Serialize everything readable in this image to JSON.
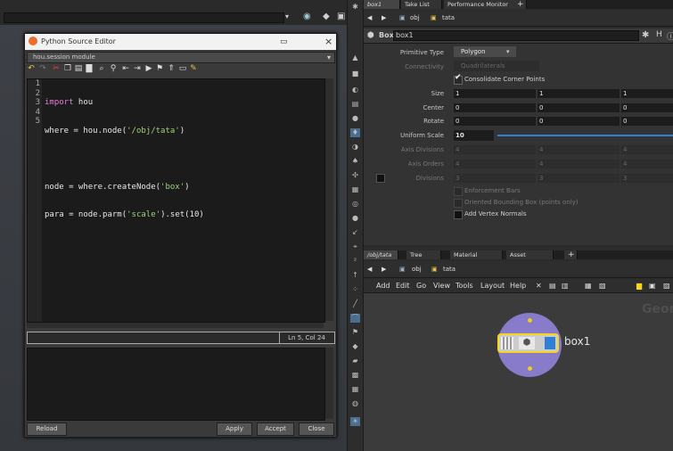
{
  "top_strip": {},
  "editor": {
    "title": "Python Source Editor",
    "module": "hou.session module",
    "line_numbers": [
      "1",
      "2",
      "3",
      "4",
      "5"
    ],
    "code_lines": [
      {
        "kw": "import",
        "rest": " hou",
        "str": "",
        "tail": ""
      },
      {
        "kw": "",
        "rest": "where = hou.node(",
        "str": "'/obj/tata'",
        "tail": ")"
      },
      {
        "kw": "",
        "rest": "",
        "str": "",
        "tail": ""
      },
      {
        "kw": "",
        "rest": "node = where.createNode(",
        "str": "'box'",
        "tail": ")"
      },
      {
        "kw": "",
        "rest": "para = node.parm(",
        "str": "'scale'",
        "tail": ").set(10)"
      }
    ],
    "status": "Ln 5, Col 24",
    "buttons": {
      "reload": "Reload",
      "apply": "Apply",
      "accept": "Accept",
      "close": "Close"
    }
  },
  "param_pane": {
    "tabs": [
      "box1",
      "Take List",
      "Performance Monitor",
      "+"
    ],
    "path": {
      "obj": "obj",
      "node": "tata"
    },
    "node_type": "Box",
    "node_name": "box1",
    "primitive_type_label": "Primitive Type",
    "primitive_type_value": "Polygon",
    "connectivity_label": "Connectivity",
    "connectivity_value": "Quadrilaterals",
    "consolidate_label": "Consolidate Corner Points",
    "size_label": "Size",
    "size": [
      "1",
      "1",
      "1"
    ],
    "center_label": "Center",
    "center": [
      "0",
      "0",
      "0"
    ],
    "rotate_label": "Rotate",
    "rotate": [
      "0",
      "0",
      "0"
    ],
    "uniform_scale_label": "Uniform Scale",
    "uniform_scale": "10",
    "axis_divisions_label": "Axis Divisions",
    "axis_divisions": [
      "4",
      "4",
      "4"
    ],
    "axis_orders_label": "Axis Orders",
    "axis_orders": [
      "4",
      "4",
      "4"
    ],
    "divisions_label": "Divisions",
    "divisions": [
      "3",
      "3",
      "3"
    ],
    "enforcement_bars": "Enforcement Bars",
    "oriented_bbox": "Oriented Bounding Box (points only)",
    "add_vertex_normals": "Add Vertex Normals"
  },
  "network_pane": {
    "tabs": [
      "/obj/tata",
      "Tree View",
      "Material Palette",
      "Asset Browser",
      "+"
    ],
    "path": {
      "obj": "obj",
      "node": "tata"
    },
    "menu": [
      "Add",
      "Edit",
      "Go",
      "View",
      "Tools",
      "Layout",
      "Help"
    ],
    "context_label": "Geom",
    "node_label": "box1"
  },
  "colors": {
    "accent_blue": "#2f7fd6",
    "node_ring": "#8d7fd1",
    "node_yellow": "#f5d51e"
  }
}
